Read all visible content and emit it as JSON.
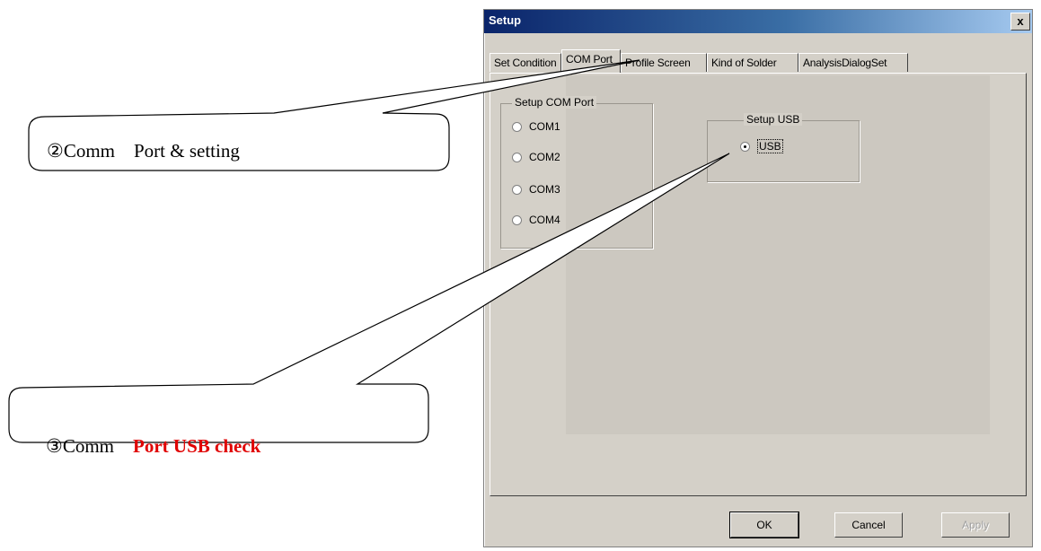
{
  "dialog": {
    "title": "Setup",
    "close_label": "x"
  },
  "tabs": [
    {
      "label": "Set Condition",
      "active": false
    },
    {
      "label": "COM Port",
      "active": true
    },
    {
      "label": "Profile Screen",
      "active": false
    },
    {
      "label": "Kind of Solder",
      "active": false
    },
    {
      "label": "AnalysisDialogSet",
      "active": false
    }
  ],
  "com_group": {
    "title": "Setup COM Port",
    "options": [
      {
        "label": "COM1",
        "checked": false
      },
      {
        "label": "COM2",
        "checked": false
      },
      {
        "label": "COM3",
        "checked": false
      },
      {
        "label": "COM4",
        "checked": false
      }
    ]
  },
  "usb_group": {
    "title": "Setup USB",
    "option": {
      "label": "USB",
      "checked": true
    }
  },
  "buttons": {
    "ok": "OK",
    "cancel": "Cancel",
    "apply": "Apply"
  },
  "callouts": {
    "callout1": "②Comm　Port & setting",
    "callout2_prefix": "③Comm　",
    "callout2_highlight": "Port USB check"
  },
  "colors": {
    "callout_highlight": "#e00000",
    "titlebar_start": "#0a246a",
    "dialog_face": "#d4d0c8"
  }
}
